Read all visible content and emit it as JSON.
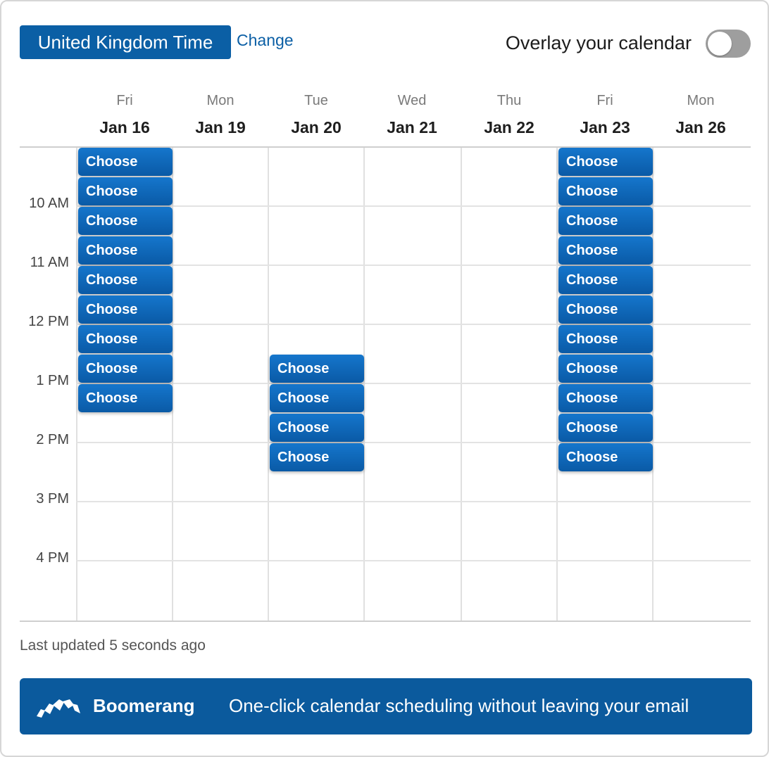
{
  "timezone": {
    "label": "United Kingdom Time",
    "change_label": "Change"
  },
  "overlay": {
    "label": "Overlay your calendar",
    "enabled": false
  },
  "days": [
    {
      "dow": "Fri",
      "date": "Jan 16"
    },
    {
      "dow": "Mon",
      "date": "Jan 19"
    },
    {
      "dow": "Tue",
      "date": "Jan 20"
    },
    {
      "dow": "Wed",
      "date": "Jan 21"
    },
    {
      "dow": "Thu",
      "date": "Jan 22"
    },
    {
      "dow": "Fri",
      "date": "Jan 23"
    },
    {
      "dow": "Mon",
      "date": "Jan 26"
    }
  ],
  "time_labels": [
    "10 AM",
    "11 AM",
    "12 PM",
    "1 PM",
    "2 PM",
    "3 PM",
    "4 PM"
  ],
  "slot_label": "Choose",
  "slots": [
    {
      "day": "Jan 16",
      "times": [
        "9:00 AM",
        "9:30 AM",
        "10:00 AM",
        "10:30 AM",
        "11:00 AM",
        "11:30 AM",
        "12:00 PM",
        "12:30 PM",
        "1:00 PM"
      ]
    },
    {
      "day": "Jan 20",
      "times": [
        "12:30 PM",
        "1:00 PM",
        "1:30 PM",
        "2:00 PM"
      ]
    },
    {
      "day": "Jan 23",
      "times": [
        "9:00 AM",
        "9:30 AM",
        "10:00 AM",
        "10:30 AM",
        "11:00 AM",
        "11:30 AM",
        "12:00 PM",
        "12:30 PM",
        "1:00 PM",
        "1:30 PM",
        "2:00 PM"
      ]
    }
  ],
  "last_updated": "Last updated 5 seconds ago",
  "footer": {
    "logo_icon": "boomerang-logo-icon",
    "brand": "Boomerang",
    "tagline": "One-click calendar scheduling without leaving your email"
  },
  "colors": {
    "primary": "#0b5fa5",
    "footer_bg": "#0b5a9d",
    "toggle_off": "#9e9e9e"
  }
}
